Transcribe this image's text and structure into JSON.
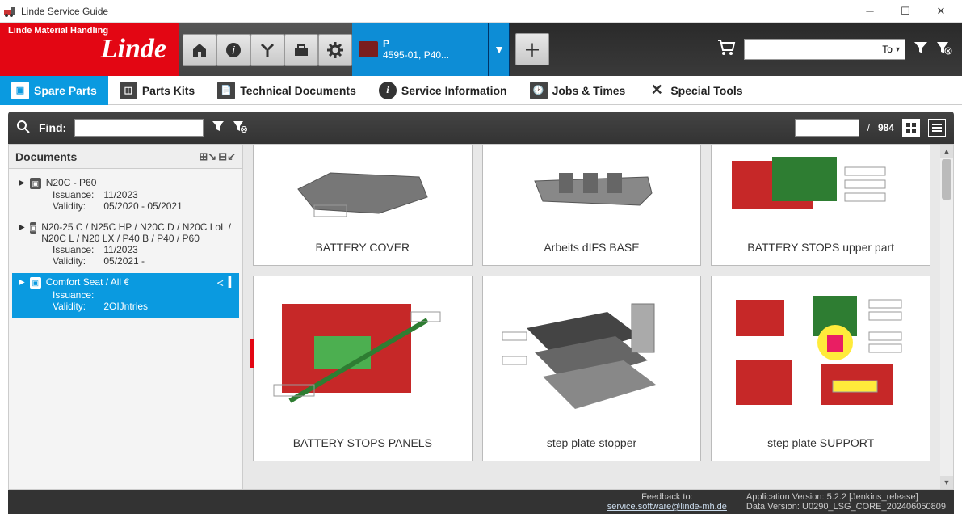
{
  "window": {
    "title": "Linde Service Guide"
  },
  "brand": {
    "tag": "Linde Material Handling",
    "logo": "Linde"
  },
  "vehicle_tab": {
    "line1": "P",
    "line2": "4595-01, P40..."
  },
  "top_select": {
    "label": "To"
  },
  "tabs": {
    "spare_parts": "Spare Parts",
    "parts_kits": "Parts Kits",
    "tech_docs": "Technical Documents",
    "service_info": "Service Information",
    "jobs_times": "Jobs & Times",
    "special_tools": "Special Tools"
  },
  "toolbar": {
    "find_label": "Find:",
    "page_sep": "/",
    "page_total": "984"
  },
  "sidebar": {
    "header": "Documents",
    "nodes": [
      {
        "title": "N20C - P60",
        "issuance_label": "Issuance:",
        "issuance": "11/2023",
        "validity_label": "Validity:",
        "validity": "05/2020 - 05/2021"
      },
      {
        "title": "N20-25 C / N25C HP / N20C D / N20C LoL / N20C L / N20 LX / P40 B / P40 / P60",
        "issuance_label": "Issuance:",
        "issuance": "11/2023",
        "validity_label": "Validity:",
        "validity": "05/2021 -"
      },
      {
        "title": "Comfort Seat / All €",
        "issuance_label": "Issuance:",
        "issuance": "",
        "validity_label": "Validity:",
        "validity": "2OIJntries"
      }
    ]
  },
  "gallery": {
    "items": [
      {
        "caption": "BATTERY COVER"
      },
      {
        "caption": "Arbeits dIFS BASE"
      },
      {
        "caption": "BATTERY STOPS upper part"
      },
      {
        "caption": "BATTERY STOPS PANELS"
      },
      {
        "caption": "step plate stopper"
      },
      {
        "caption": "step plate SUPPORT"
      }
    ]
  },
  "status": {
    "feedback_label": "Feedback to:",
    "feedback_email": "service.software@linde-mh.de",
    "app_version": "Application Version: 5.2.2 [Jenkins_release]",
    "data_version": "Data Version: U0290_LSG_CORE_202406050809"
  }
}
